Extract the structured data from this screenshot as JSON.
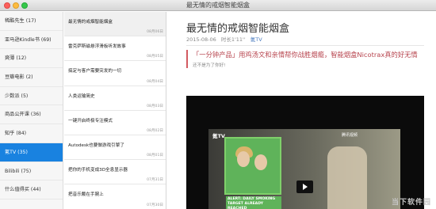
{
  "window": {
    "title": "最无情的戒烟智能烟盒"
  },
  "sidebar": {
    "items": [
      {
        "label": "稀酷先生 (17)"
      },
      {
        "label": "亚马逊Kindle书 (69)"
      },
      {
        "label": "爽薄 (12)"
      },
      {
        "label": "豆瓣电影 (2)"
      },
      {
        "label": "少数派 (5)"
      },
      {
        "label": "商品公开课 (36)"
      },
      {
        "label": "知乎 (84)"
      },
      {
        "label": "氪TV (35)"
      },
      {
        "label": "Bilibili (75)"
      },
      {
        "label": "什么值得买 (44)"
      }
    ],
    "active_index": 7
  },
  "list": {
    "items": [
      {
        "title": "最无情的戒烟智能烟盒",
        "date": "08月06日"
      },
      {
        "title": "雷克萨斯磁悬浮滑板听发故事",
        "date": "08月05日"
      },
      {
        "title": "搞定与客户需要突发的一切",
        "date": "08月04日"
      },
      {
        "title": "人类运输简史",
        "date": "08月03日"
      },
      {
        "title": "一键开启终极专注模式",
        "date": "08月02日"
      },
      {
        "title": "Autodesk也要做游戏引擎了",
        "date": "08月01日"
      },
      {
        "title": "把你的手机变成3D全息显示器",
        "date": "07月31日"
      },
      {
        "title": "把音乐戴在手腕上",
        "date": "07月30日"
      }
    ]
  },
  "article": {
    "title": "最无情的戒烟智能烟盒",
    "date": "2015-08-06",
    "duration": "时长1'11''",
    "source": "氪TV",
    "quote": "「一分钟产品」用鸡汤文和亲情帮你战胜烟瘾，智能烟盒Nicotrax真的好无情",
    "quote_sub": "还不是为了你好!"
  },
  "video": {
    "logo": "氪TV",
    "provider": "腾讯视频",
    "caption": "ALERT: DAILY SMOKING TARGET ALREADY REACHED"
  },
  "watermark": "当下软件园",
  "colors": {
    "accent": "#1982e0",
    "quote": "#b7444e"
  }
}
